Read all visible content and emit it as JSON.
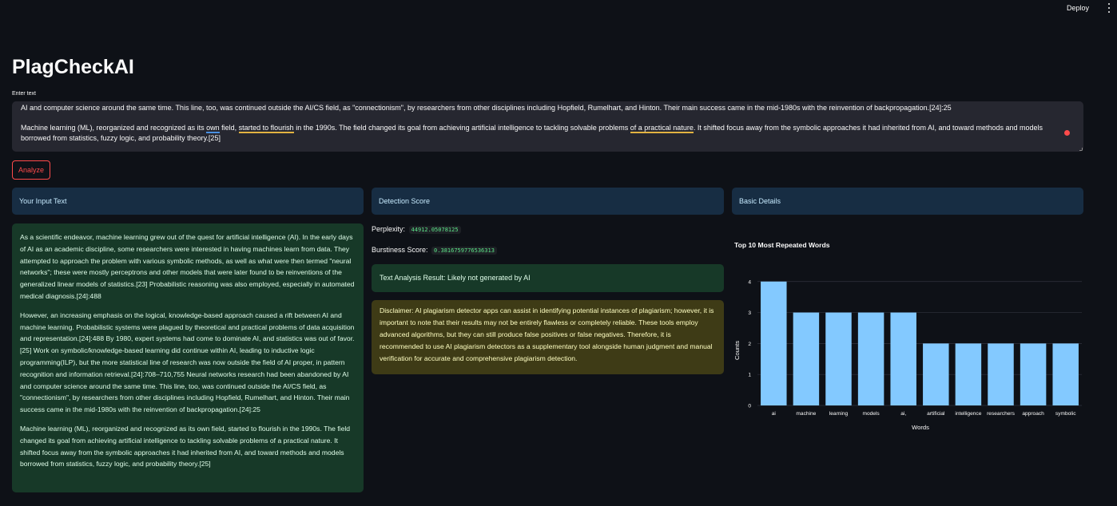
{
  "topbar": {
    "deploy_label": "Deploy"
  },
  "app": {
    "title": "PlagCheckAI"
  },
  "input": {
    "label": "Enter text",
    "visible_lines": [
      "AI and computer science around the same time. This line, too, was continued outside the AI/CS field, as \"connectionism\", by researchers from other disciplines including Hopfield, Rumelhart, and Hinton. Their main success came in the mid-1980s with the reinvention of backpropagation.[24]:25",
      "Machine learning (ML), reorganized and recognized as its own field, started to flourish in the 1990s. The field changed its goal from achieving artificial intelligence to tackling solvable problems of a practical nature. It shifted focus away from the symbolic approaches it had inherited from AI, and toward methods and models borrowed from statistics, fuzzy logic, and probability theory.[25]"
    ],
    "line2_part1": "Machine learning (ML), reorganized and recognized as its ",
    "line2_own": "own",
    "line2_part2": " field, ",
    "line2_flourish": "started to flourish",
    "line2_part3": " in the 1990s. The field changed its goal from achieving artificial intelligence to tackling solvable problems ",
    "line2_practical": "of a practical nature",
    "line2_part4": ". It shifted focus away from the symbolic approaches it had inherited from AI, and toward methods and models borrowed from statistics, fuzzy logic, and probability theory.[25]"
  },
  "analyze_button": {
    "label": "Analyze"
  },
  "columns": {
    "input_header": "Your Input Text",
    "detection_header": "Detection Score",
    "details_header": "Basic Details"
  },
  "input_text": {
    "paragraphs": [
      "As a scientific endeavor, machine learning grew out of the quest for artificial intelligence (AI). In the early days of AI as an academic discipline, some researchers were interested in having machines learn from data. They attempted to approach the problem with various symbolic methods, as well as what were then termed \"neural networks\"; these were mostly perceptrons and other models that were later found to be reinventions of the generalized linear models of statistics.[23] Probabilistic reasoning was also employed, especially in automated medical diagnosis.[24]:488",
      "However, an increasing emphasis on the logical, knowledge-based approach caused a rift between AI and machine learning. Probabilistic systems were plagued by theoretical and practical problems of data acquisition and representation.[24]:488 By 1980, expert systems had come to dominate AI, and statistics was out of favor.[25] Work on symbolic/knowledge-based learning did continue within AI, leading to inductive logic programming(ILP), but the more statistical line of research was now outside the field of AI proper, in pattern recognition and information retrieval.[24]:708–710,755 Neural networks research had been abandoned by AI and computer science around the same time. This line, too, was continued outside the AI/CS field, as \"connectionism\", by researchers from other disciplines including Hopfield, Rumelhart, and Hinton. Their main success came in the mid-1980s with the reinvention of backpropagation.[24]:25",
      "Machine learning (ML), reorganized and recognized as its own field, started to flourish in the 1990s. The field changed its goal from achieving artificial intelligence to tackling solvable problems of a practical nature. It shifted focus away from the symbolic approaches it had inherited from AI, and toward methods and models borrowed from statistics, fuzzy logic, and probability theory.[25]"
    ]
  },
  "detection": {
    "perplexity_label": "Perplexity:",
    "perplexity_value": "44912.05078125",
    "burstiness_label": "Burstiness Score:",
    "burstiness_value": "0.3816759776536313",
    "result_text": "Text Analysis Result: Likely not generated by AI",
    "disclaimer": "Disclaimer: AI plagiarism detector apps can assist in identifying potential instances of plagiarism; however, it is important to note that their results may not be entirely flawless or completely reliable. These tools employ advanced algorithms, but they can still produce false positives or false negatives. Therefore, it is recommended to use AI plagiarism detectors as a supplementary tool alongside human judgment and manual verification for accurate and comprehensive plagiarism detection."
  },
  "colors": {
    "background": "#0e1117",
    "accent": "#ff4b4b",
    "info_bg": "#172d43",
    "success_bg": "#173928",
    "warning_bg": "#3e3b16",
    "bar": "#83c9ff"
  },
  "chart_data": {
    "type": "bar",
    "title": "Top 10 Most Repeated Words",
    "xlabel": "Words",
    "ylabel": "Counts",
    "categories": [
      "ai",
      "machine",
      "learning",
      "models",
      "ai,",
      "artificial",
      "intelligence",
      "researchers",
      "approach",
      "symbolic"
    ],
    "values": [
      4,
      3,
      3,
      3,
      3,
      2,
      2,
      2,
      2,
      2
    ],
    "ylim": [
      0,
      4.2
    ],
    "yticks": [
      0,
      1,
      2,
      3,
      4
    ],
    "grid": true
  }
}
